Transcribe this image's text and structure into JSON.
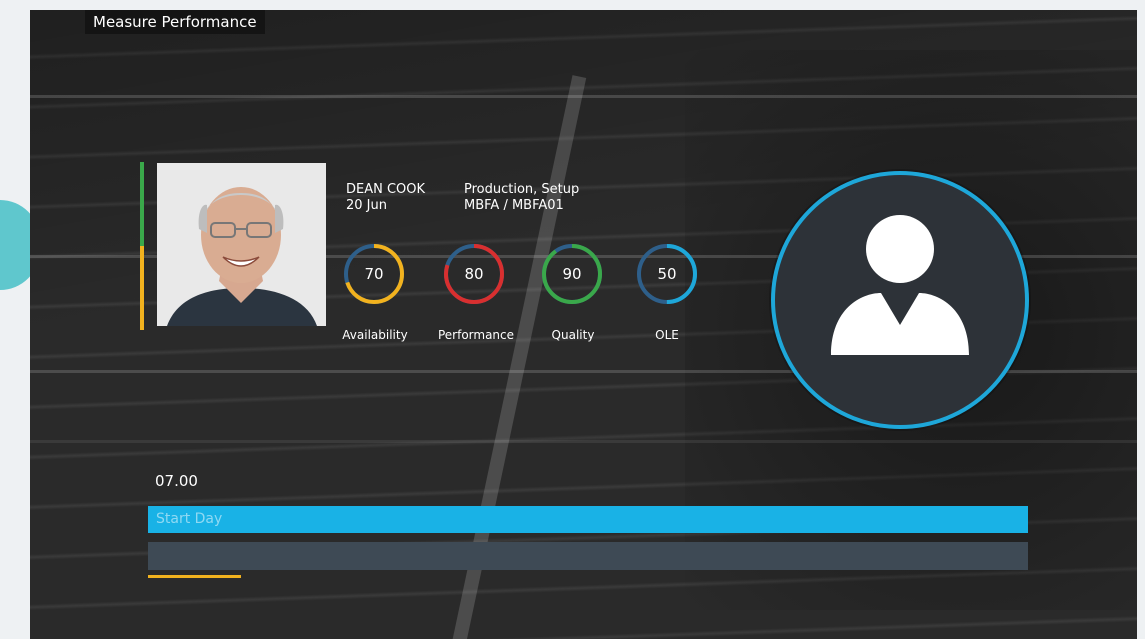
{
  "header": {
    "title": "Measure Performance"
  },
  "employee": {
    "name": "DEAN COOK",
    "date": "20 Jun",
    "department": "Production, Setup",
    "line": "MBFA / MBFA01"
  },
  "metrics": [
    {
      "label": "Availability",
      "value": "70",
      "level": 0.7,
      "color": "#f2b21e"
    },
    {
      "label": "Performance",
      "value": "80",
      "level": 0.8,
      "color": "#d92f2f"
    },
    {
      "label": "Quality",
      "value": "90",
      "level": 0.9,
      "color": "#3aa84a"
    },
    {
      "label": "OLE",
      "value": "50",
      "level": 0.5,
      "color": "#1ea7d9"
    }
  ],
  "timeline": {
    "time": "07.00",
    "start_label": "Start Day"
  },
  "colors": {
    "accent_blue": "#19b2e6",
    "green": "#3aa84a",
    "yellow": "#f2b21e",
    "red": "#d92f2f"
  },
  "icons": {
    "avatar": "user-silhouette-icon"
  }
}
